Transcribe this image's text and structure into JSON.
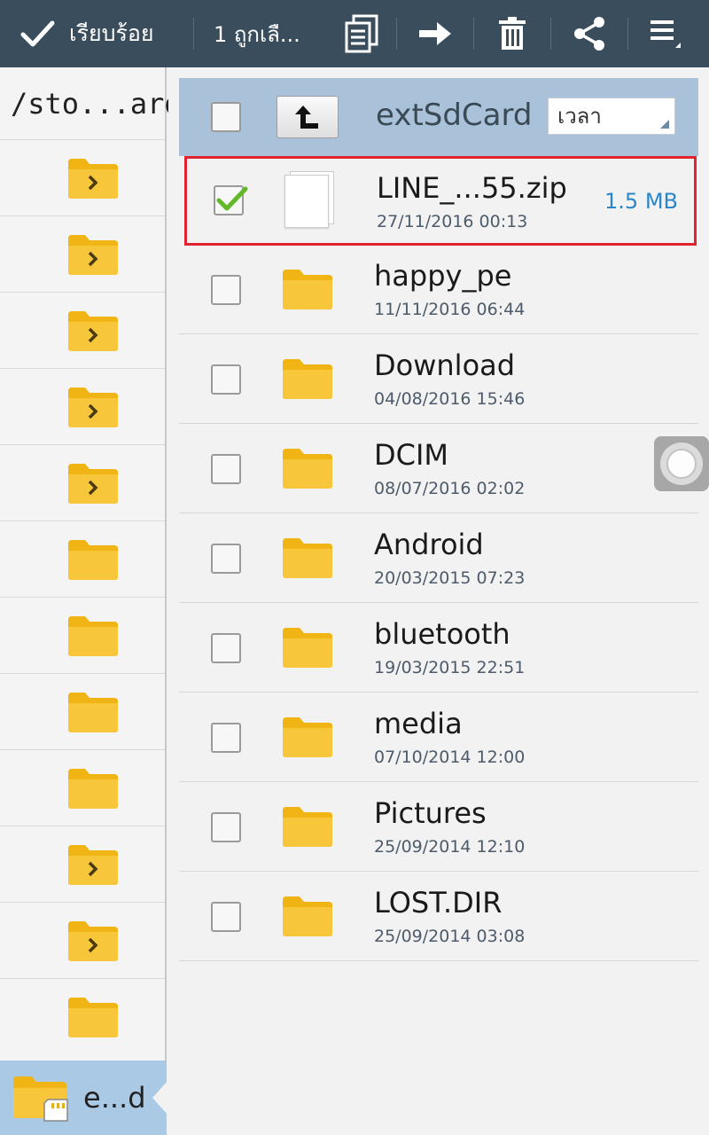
{
  "actionbar": {
    "done_label": "เรียบร้อย",
    "selected_label": "1 ถูกเลื...",
    "background": "#3a4d5c",
    "actions": [
      "copy-icon",
      "move-icon",
      "delete-icon",
      "share-icon",
      "menu-icon"
    ]
  },
  "left_panel": {
    "path_label": "/sto...ard",
    "current_storage_label": "e...d",
    "highlight_color": "#a9c9e4"
  },
  "header": {
    "title": "extSdCard",
    "sort_value": "เวลา"
  },
  "files": [
    {
      "name": "LINE_...55.zip",
      "date": "27/11/2016 00:13",
      "size": "1.5 MB",
      "type": "file",
      "checked": true
    },
    {
      "name": "happy_pe",
      "date": "11/11/2016 06:44",
      "type": "folder",
      "checked": false
    },
    {
      "name": "Download",
      "date": "04/08/2016 15:46",
      "type": "folder",
      "checked": false
    },
    {
      "name": "DCIM",
      "date": "08/07/2016 02:02",
      "type": "folder",
      "checked": false
    },
    {
      "name": "Android",
      "date": "20/03/2015 07:23",
      "type": "folder",
      "checked": false
    },
    {
      "name": "bluetooth",
      "date": "19/03/2015 22:51",
      "type": "folder",
      "checked": false
    },
    {
      "name": "media",
      "date": "07/10/2014 12:00",
      "type": "folder",
      "checked": false
    },
    {
      "name": "Pictures",
      "date": "25/09/2014 12:10",
      "type": "folder",
      "checked": false
    },
    {
      "name": "LOST.DIR",
      "date": "25/09/2014 03:08",
      "type": "folder",
      "checked": false
    }
  ],
  "colors": {
    "selection_border": "#e0232e",
    "size_text": "#2a86c8",
    "folder": "#f5b90f"
  }
}
